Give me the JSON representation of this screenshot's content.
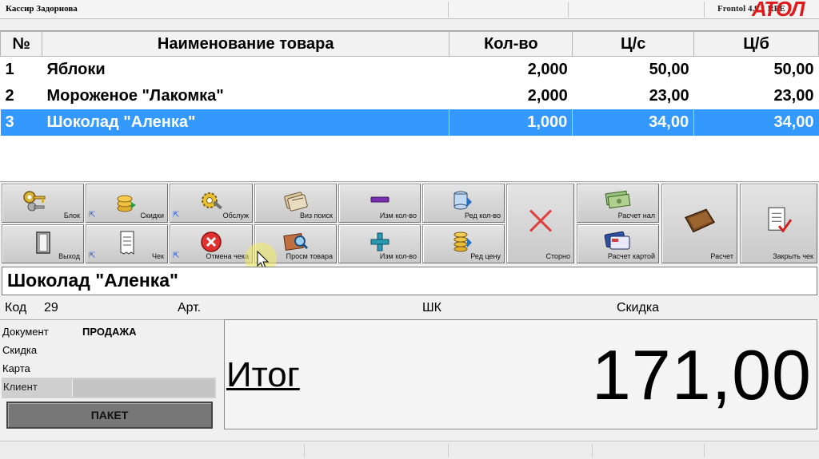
{
  "titlebar": {
    "cashier": "Кассир Задорнова",
    "version": "Frontol 4.9.1 RFE",
    "logo": "АТОЛ"
  },
  "table": {
    "headers": [
      "№",
      "Наименование товара",
      "Кол-во",
      "Ц/с",
      "Ц/б"
    ],
    "rows": [
      {
        "num": "1",
        "name": "Яблоки",
        "qty": "2,000",
        "price": "50,00",
        "sum": "50,00"
      },
      {
        "num": "2",
        "name": "Мороженое \"Лакомка\"",
        "qty": "2,000",
        "price": "23,00",
        "sum": "23,00"
      },
      {
        "num": "3",
        "name": "Шоколад \"Аленка\"",
        "qty": "1,000",
        "price": "34,00",
        "sum": "34,00"
      }
    ],
    "selected_row": 3
  },
  "buttons": {
    "block": "Блок",
    "discounts": "Скидки",
    "service": "Обслуж",
    "visual_search": "Виз поиск",
    "change_qty_minus": "Изм кол-во",
    "edit_qty": "Ред кол-во",
    "storno": "Сторно",
    "calc_cash": "Расчет нал",
    "calc": "Расчет",
    "close_check": "Закрыть чек",
    "exit": "Выход",
    "check": "Чек",
    "cancel_check": "Отмена чека",
    "view_goods": "Просм товара",
    "change_qty_plus": "Изм кол-во",
    "edit_price": "Ред цену",
    "calc_card": "Расчет картой"
  },
  "product": {
    "name": "Шоколад \"Аленка\""
  },
  "info": {
    "code_label": "Код",
    "code_value": "29",
    "art_label": "Арт.",
    "barcode_label": "ШК",
    "discount_label": "Скидка"
  },
  "left": {
    "document_label": "Документ",
    "document_value": "ПРОДАЖА",
    "discount_label": "Скидка",
    "card_label": "Карта",
    "client_label": "Клиент",
    "paket": "ПАКЕТ"
  },
  "total": {
    "label": "Итог",
    "value": "171,00"
  },
  "colors": {
    "selection": "#3399ff",
    "storno_x": "#e04040",
    "logo": "#e01a1a"
  }
}
